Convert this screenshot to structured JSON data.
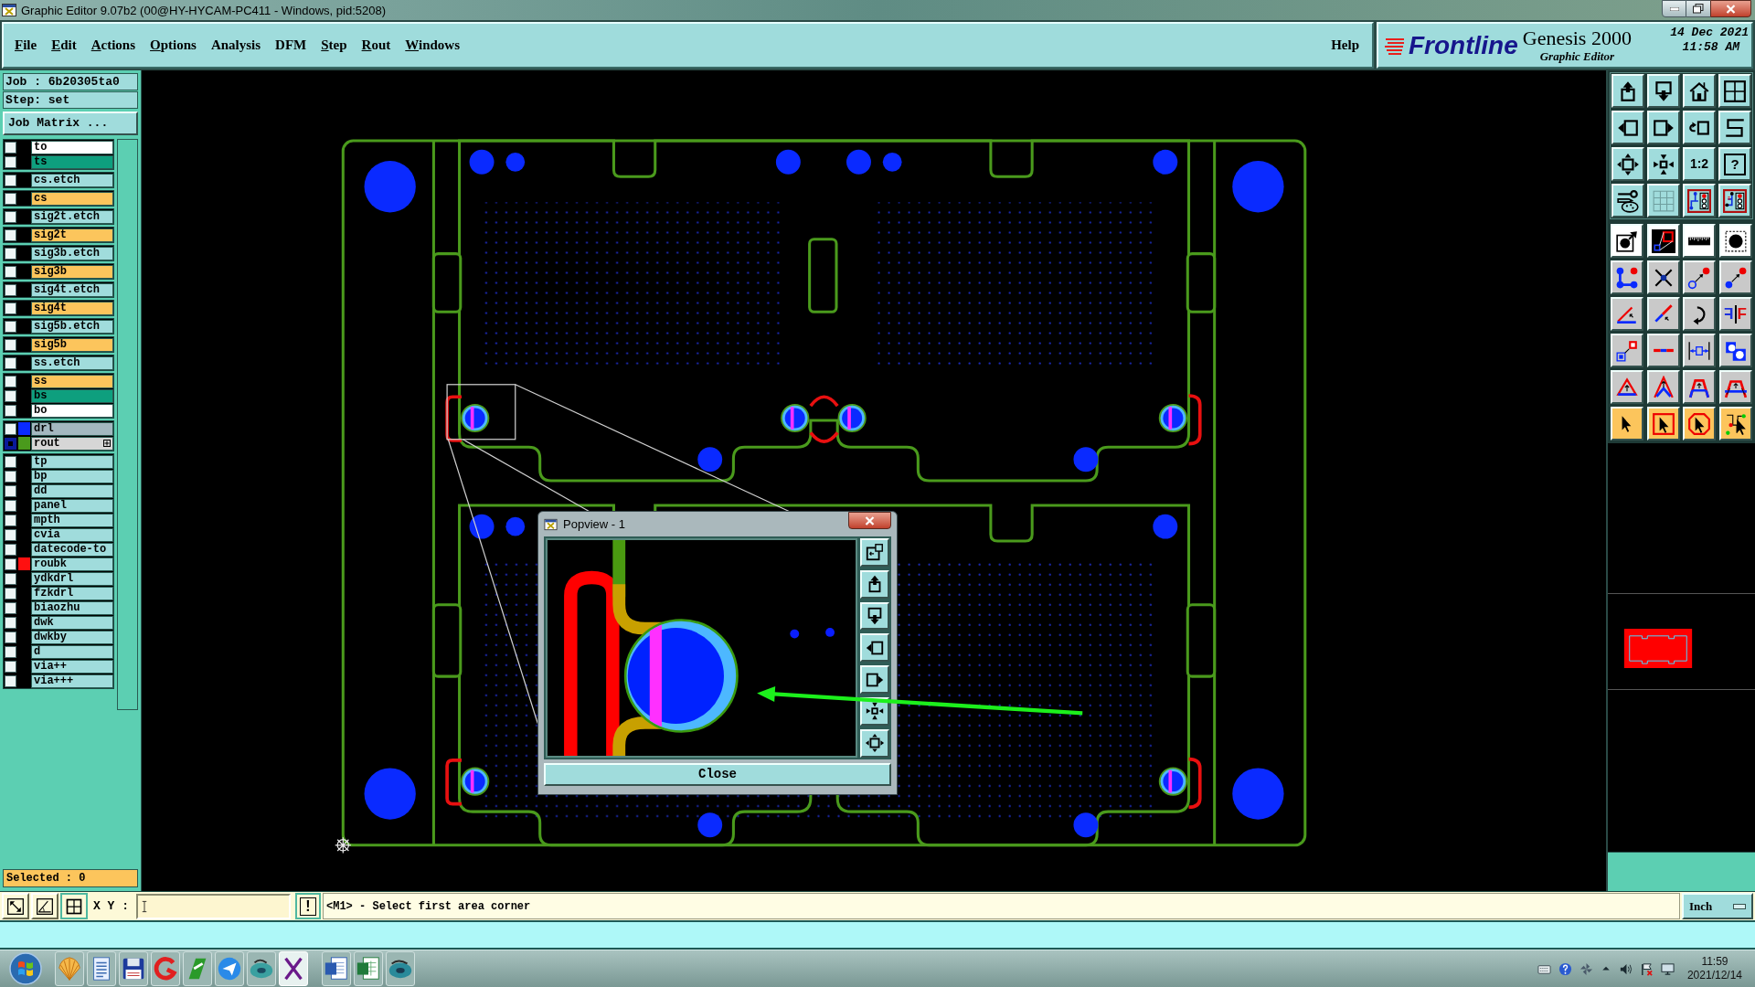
{
  "window": {
    "title": "Graphic Editor 9.07b2 (00@HY-HYCAM-PC411 - Windows, pid:5208)"
  },
  "menu": {
    "items": [
      {
        "label": "File",
        "underlined": true
      },
      {
        "label": "Edit",
        "underlined": true
      },
      {
        "label": "Actions",
        "underlined": true
      },
      {
        "label": "Options",
        "underlined": true
      },
      {
        "label": "Analysis",
        "underlined": false
      },
      {
        "label": "DFM",
        "underlined": false
      },
      {
        "label": "Step",
        "underlined": true
      },
      {
        "label": "Rout",
        "underlined": true
      },
      {
        "label": "Windows",
        "underlined": true
      }
    ],
    "help": "Help"
  },
  "brand": {
    "logo": "Frontline",
    "product": "Genesis 2000",
    "subtitle": "Graphic Editor",
    "date": "14 Dec 2021",
    "time": "11:58 AM"
  },
  "job_panel": {
    "job": "Job : 6b20305ta0",
    "step": "Step: set",
    "matrix_button": "Job Matrix ...",
    "layer_groups": [
      {
        "layers": [
          {
            "name": "to",
            "color": "#ffffff",
            "selected": false
          },
          {
            "name": "ts",
            "color": "#0e9f7e",
            "selected": false
          }
        ]
      },
      {
        "layers": [
          {
            "name": "cs.etch",
            "color": "#a0dcdc",
            "selected": false
          }
        ]
      },
      {
        "layers": [
          {
            "name": "cs",
            "color": "#fcc55c",
            "selected": false
          }
        ]
      },
      {
        "layers": [
          {
            "name": "sig2t.etch",
            "color": "#a0dcdc",
            "selected": false
          }
        ]
      },
      {
        "layers": [
          {
            "name": "sig2t",
            "color": "#fcc55c",
            "selected": false
          }
        ]
      },
      {
        "layers": [
          {
            "name": "sig3b.etch",
            "color": "#a0dcdc",
            "selected": false
          }
        ]
      },
      {
        "layers": [
          {
            "name": "sig3b",
            "color": "#fcc55c",
            "selected": false
          }
        ]
      },
      {
        "layers": [
          {
            "name": "sig4t.etch",
            "color": "#a0dcdc",
            "selected": false
          }
        ]
      },
      {
        "layers": [
          {
            "name": "sig4t",
            "color": "#fcc55c",
            "selected": false
          }
        ]
      },
      {
        "layers": [
          {
            "name": "sig5b.etch",
            "color": "#a0dcdc",
            "selected": false
          }
        ]
      },
      {
        "layers": [
          {
            "name": "sig5b",
            "color": "#fcc55c",
            "selected": false
          }
        ]
      },
      {
        "layers": [
          {
            "name": "ss.etch",
            "color": "#a0dcdc",
            "selected": false
          }
        ]
      },
      {
        "layers": [
          {
            "name": "ss",
            "color": "#fcc55c",
            "selected": false
          },
          {
            "name": "bs",
            "color": "#0e9f7e",
            "selected": false
          },
          {
            "name": "bo",
            "color": "#ffffff",
            "selected": false
          }
        ]
      },
      {
        "layers": [
          {
            "name": "drl",
            "color": "#a3b8c0",
            "swatch": {
              "color": "#0a2aff"
            },
            "selected": false
          },
          {
            "name": "rout",
            "color": "#d6d6d6",
            "swatch": {
              "color": "#4a9a1c"
            },
            "selected": true,
            "marked": true
          }
        ]
      },
      {
        "layers": [
          {
            "name": "tp",
            "color": "#a0dcdc",
            "selected": false
          },
          {
            "name": "bp",
            "color": "#a0dcdc",
            "selected": false
          },
          {
            "name": "dd",
            "color": "#a0dcdc",
            "selected": false
          },
          {
            "name": "panel",
            "color": "#a0dcdc",
            "selected": false
          },
          {
            "name": "mpth",
            "color": "#a0dcdc",
            "selected": false
          },
          {
            "name": "cvia",
            "color": "#a0dcdc",
            "selected": false
          },
          {
            "name": "datecode-to",
            "color": "#a0dcdc",
            "selected": false
          },
          {
            "name": "roubk",
            "color": "#a0dcdc",
            "swatch": {
              "color": "#ff1010"
            },
            "selected": false
          },
          {
            "name": "ydkdrl",
            "color": "#a0dcdc",
            "selected": false
          },
          {
            "name": "fzkdrl",
            "color": "#a0dcdc",
            "selected": false
          },
          {
            "name": "biaozhu",
            "color": "#a0dcdc",
            "selected": false
          },
          {
            "name": "dwk",
            "color": "#a0dcdc",
            "selected": false
          },
          {
            "name": "dwkby",
            "color": "#a0dcdc",
            "selected": false
          },
          {
            "name": "d",
            "color": "#a0dcdc",
            "selected": false
          },
          {
            "name": "via++",
            "color": "#a0dcdc",
            "selected": false
          },
          {
            "name": "via+++",
            "color": "#a0dcdc",
            "selected": false
          }
        ]
      }
    ],
    "selected_count": "Selected : 0"
  },
  "right_toolbar": {
    "scale_label": "1:2",
    "help_label": "?",
    "mirror_labels": [
      "F",
      "F"
    ]
  },
  "popview": {
    "title": "Popview - 1",
    "close_button": "Close"
  },
  "status_bar": {
    "xy_label": "X Y :",
    "alert_button": "!",
    "message": "<M1> - Select first area corner",
    "units": "Inch"
  },
  "taskbar": {
    "apps": [
      {
        "selected": false
      },
      {
        "selected": false
      },
      {
        "selected": false
      },
      {
        "selected": false
      },
      {
        "selected": false
      },
      {
        "selected": false
      },
      {
        "selected": false
      },
      {
        "selected": true
      },
      {
        "selected": false
      },
      {
        "selected": false
      },
      {
        "selected": false
      }
    ],
    "time": "11:59",
    "date": "2021/12/14"
  }
}
